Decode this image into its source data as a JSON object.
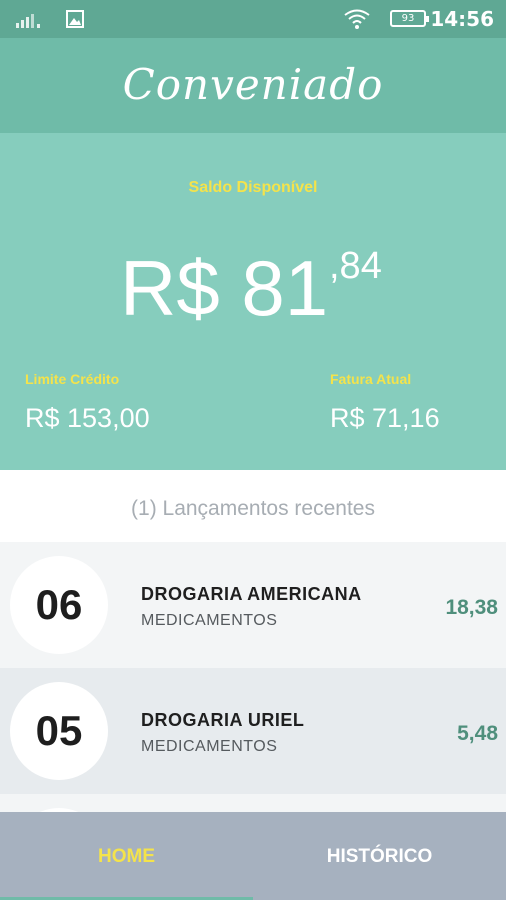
{
  "status_bar": {
    "battery": "93",
    "time": "14:56",
    "icons": [
      "signal-icon",
      "image-icon",
      "wifi-icon",
      "battery-icon"
    ]
  },
  "app_bar": {
    "title": "Conveniado"
  },
  "balance": {
    "label": "Saldo Disponível",
    "amount_main": "R$ 81",
    "amount_cents": ",84",
    "limit_label": "Limite Crédito",
    "limit_value": "R$ 153,00",
    "invoice_label": "Fatura Atual",
    "invoice_value": "R$ 71,16"
  },
  "recent": {
    "header": "(1) Lançamentos recentes",
    "items": [
      {
        "day": "06",
        "merchant": "DROGARIA AMERICANA",
        "category": "MEDICAMENTOS",
        "amount": "18,38"
      },
      {
        "day": "05",
        "merchant": "DROGARIA URIEL",
        "category": "MEDICAMENTOS",
        "amount": "5,48"
      }
    ]
  },
  "bottom_nav": {
    "home": "HOME",
    "history": "HISTÓRICO",
    "active": "home"
  },
  "colors": {
    "status_bar": "#5fa894",
    "app_bar": "#6fbba8",
    "balance_panel": "#86cdbd",
    "label_yellow": "#f4e34b",
    "amount_green": "#4f8f7c",
    "nav_bg": "#a6b1bf"
  }
}
